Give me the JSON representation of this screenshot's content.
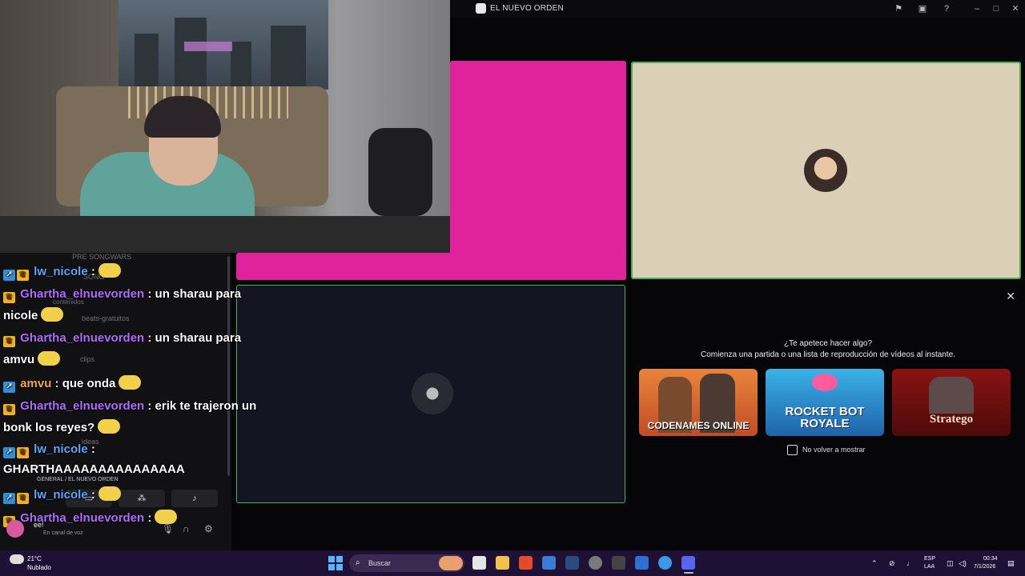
{
  "window": {
    "title": "EL NUEVO ORDEN"
  },
  "chat": {
    "messages": [
      {
        "user": "lw_nicole",
        "text": " :"
      },
      {
        "user": "Ghartha_elnuevorden",
        "text": " : un sharau para"
      },
      {
        "user": "",
        "text": "nicole"
      },
      {
        "user": "Ghartha_elnuevorden",
        "text": " : un sharau para"
      },
      {
        "user": "",
        "text": "amvu"
      },
      {
        "user": "amvu",
        "text": " : que onda"
      },
      {
        "user": "Ghartha_elnuevorden",
        "text": " : erik te trajeron un"
      },
      {
        "user": "",
        "text": "bonk los reyes?"
      },
      {
        "user": "lw_nicole",
        "text": " :"
      },
      {
        "user": "",
        "text": "GHARTHAAAAAAAAAAAAAAA"
      },
      {
        "user": "lw_nicole",
        "text": " :"
      },
      {
        "user": "Ghartha_elnuevorden",
        "text": " :"
      }
    ]
  },
  "sidebar": {
    "channels": [
      "PRE SONGWARS",
      "SONG",
      "contenidos",
      "beats-gratuitos",
      "clips",
      "ideas"
    ]
  },
  "voice": {
    "channel": "GENERAL / EL NUEVO ORDEN"
  },
  "user": {
    "name": "ee!",
    "status": "En canal de voz"
  },
  "activity": {
    "heading": "¿Te apetece hacer algo?",
    "subheading": "Comienza una partida o una lista de reproducción de vídeos al instante.",
    "games": [
      {
        "name": "CODENAMES ONLINE"
      },
      {
        "name": "ROCKET BOT ROYALE"
      },
      {
        "name": "Stratego"
      }
    ],
    "dont_show_label": "No volver a mostrar"
  },
  "taskbar": {
    "weather_temp": "21°C",
    "weather_desc": "Nublado",
    "search_placeholder": "Buscar",
    "lang_line1": "ESP",
    "lang_line2": "LAA",
    "time": "00:34",
    "date": "7/1/2026"
  },
  "colors": {
    "pink_tile": "#e0239a",
    "beige_tile": "#dbcfb7",
    "speaking_border": "#4caf50",
    "taskbar": "#1f1136"
  }
}
